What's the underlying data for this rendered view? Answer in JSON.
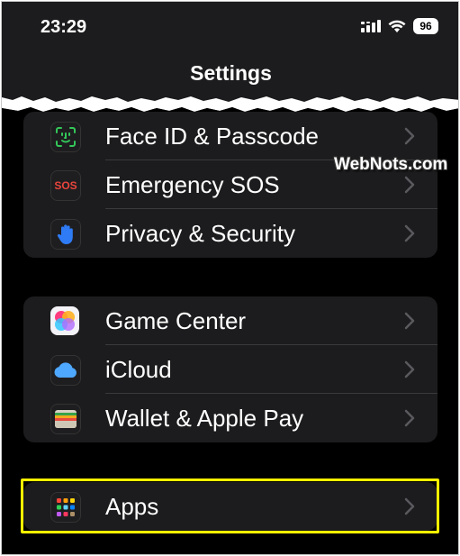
{
  "status_bar": {
    "time": "23:29",
    "battery": "96",
    "icons": [
      "signal-icon",
      "wifi-icon",
      "battery-icon"
    ]
  },
  "header": {
    "title": "Settings"
  },
  "watermark": "WebNots.com",
  "groups": [
    {
      "items": [
        {
          "label": "Face ID & Passcode",
          "icon": "face-id-icon",
          "icon_color": "#2c2c2e"
        },
        {
          "label": "Emergency SOS",
          "icon": "sos-icon",
          "icon_text": "SOS",
          "icon_color": "#2c2c2e"
        },
        {
          "label": "Privacy & Security",
          "icon": "hand-icon",
          "icon_color": "#2c2c2e"
        }
      ]
    },
    {
      "items": [
        {
          "label": "Game Center",
          "icon": "game-center-icon",
          "icon_color": "#2c2c2e"
        },
        {
          "label": "iCloud",
          "icon": "icloud-icon",
          "icon_color": "#2c2c2e"
        },
        {
          "label": "Wallet & Apple Pay",
          "icon": "wallet-icon",
          "icon_color": "#2c2c2e"
        }
      ]
    },
    {
      "items": [
        {
          "label": "Apps",
          "icon": "apps-grid-icon",
          "icon_color": "#2c2c2e",
          "highlighted": true
        }
      ]
    }
  ],
  "colors": {
    "background": "#000000",
    "cell": "#1c1c1e",
    "highlight": "#fff200",
    "sos_red": "#e8453c"
  }
}
